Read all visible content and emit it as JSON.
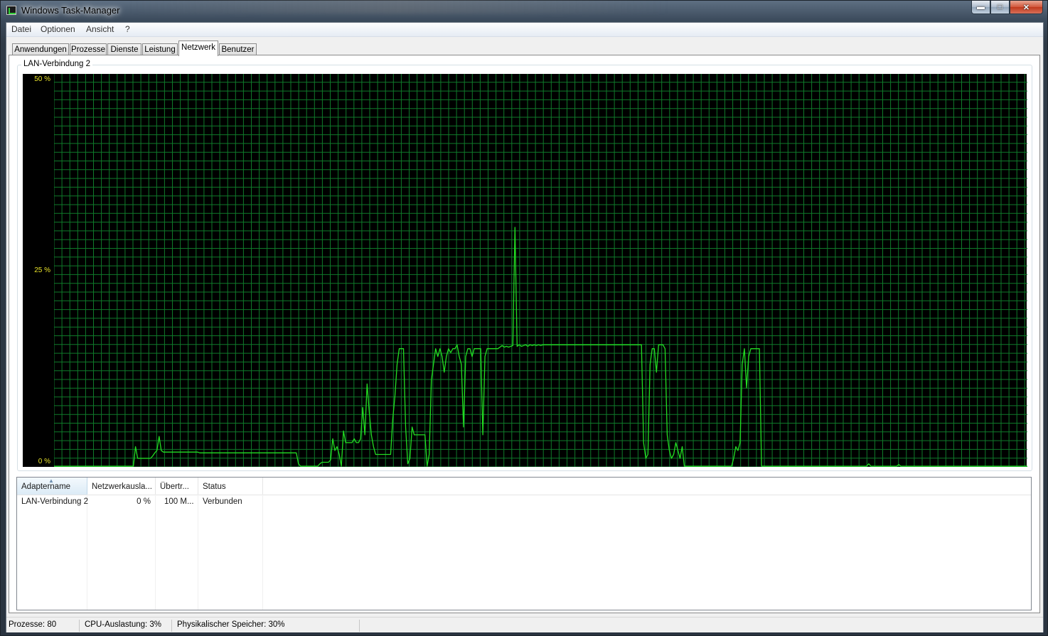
{
  "window": {
    "title": "Windows Task-Manager"
  },
  "menu": [
    "Datei",
    "Optionen",
    "Ansicht",
    "?"
  ],
  "tabs": [
    "Anwendungen",
    "Prozesse",
    "Dienste",
    "Leistung",
    "Netzwerk",
    "Benutzer"
  ],
  "active_tab": "Netzwerk",
  "graph": {
    "title": "LAN-Verbindung 2",
    "y_labels": {
      "top": "50 %",
      "mid": "25 %",
      "bottom": "0 %"
    },
    "colors": {
      "line": "#22dd22",
      "grid": "#0f7a2a",
      "background": "#000000",
      "labels": "#e8e22a"
    }
  },
  "chart_data": {
    "type": "line",
    "title": "LAN-Verbindung 2",
    "xlabel": "",
    "ylabel": "",
    "ylim": [
      0,
      50
    ],
    "grid": true,
    "series": [
      {
        "values": [
          0,
          0,
          0,
          0,
          0,
          0,
          0,
          0,
          0,
          0,
          0,
          0,
          0,
          0,
          0,
          0,
          0,
          0,
          0,
          0,
          0,
          0,
          0,
          0,
          0,
          0,
          0,
          0,
          0,
          0,
          0,
          0,
          0,
          0,
          0,
          0,
          0,
          0,
          2.5,
          1.0,
          1.0,
          1.0,
          1.0,
          1.0,
          1.0,
          1.0,
          1.3,
          1.7,
          2.0,
          3.8,
          2.0,
          1.8,
          1.8,
          1.8,
          1.8,
          1.8,
          1.8,
          1.8,
          1.8,
          1.8,
          1.8,
          1.8,
          1.8,
          1.8,
          1.8,
          1.8,
          1.8,
          1.8,
          1.7,
          1.7,
          1.7,
          1.7,
          1.7,
          1.7,
          1.7,
          1.7,
          1.7,
          1.7,
          1.7,
          1.7,
          1.7,
          1.7,
          1.7,
          1.7,
          1.7,
          1.7,
          1.7,
          1.7,
          1.7,
          1.7,
          1.7,
          1.7,
          1.7,
          1.7,
          1.7,
          1.7,
          1.7,
          1.7,
          1.7,
          1.7,
          1.7,
          1.7,
          1.7,
          1.7,
          1.7,
          1.7,
          1.7,
          1.7,
          1.7,
          1.7,
          1.7,
          1.7,
          1.7,
          1.7,
          0.3,
          0,
          0,
          0,
          0,
          0,
          0,
          0,
          0,
          0,
          0.3,
          0.5,
          0.5,
          0.5,
          0.5,
          0.8,
          3.5,
          2.0,
          2.5,
          1.5,
          0,
          4.5,
          3.0,
          3.0,
          3.0,
          3.0,
          3.5,
          3.0,
          3.0,
          3.5,
          7.5,
          4.0,
          10.5,
          7.0,
          4.0,
          2.5,
          1.5,
          1.5,
          1.5,
          1.5,
          1.5,
          1.5,
          1.5,
          1.5,
          6.0,
          9.0,
          13.0,
          15.0,
          15.0,
          15.0,
          5.0,
          0.3,
          1.0,
          5.0,
          4.0,
          4.0,
          4.0,
          4.0,
          4.0,
          4.0,
          0,
          1.5,
          11.0,
          13.0,
          15.0,
          14.0,
          15.0,
          14.0,
          12.0,
          14.0,
          15.0,
          14.5,
          15.0,
          15.0,
          15.5,
          14.0,
          13.0,
          5.0,
          14.0,
          15.0,
          15.0,
          14.0,
          15.0,
          15.0,
          15.0,
          15.0,
          4.0,
          14.0,
          15.0,
          15.0,
          15.0,
          15.0,
          15.0,
          15.0,
          15.2,
          15.4,
          15.2,
          15.3,
          15.2,
          15.3,
          15.4,
          30.5,
          15.3,
          15.5,
          15.3,
          15.4,
          15.5,
          15.3,
          15.5,
          15.4,
          15.5,
          15.4,
          15.5,
          15.4,
          15.5,
          15.5,
          15.5,
          15.5,
          15.5,
          15.5,
          15.5,
          15.5,
          15.5,
          15.5,
          15.5,
          15.5,
          15.5,
          15.5,
          15.5,
          15.5,
          15.5,
          15.5,
          15.5,
          15.5,
          15.5,
          15.5,
          15.5,
          15.5,
          15.5,
          15.5,
          15.5,
          15.5,
          15.5,
          15.5,
          15.5,
          15.5,
          15.5,
          15.5,
          15.5,
          15.5,
          15.5,
          15.5,
          15.5,
          15.5,
          15.5,
          15.5,
          15.5,
          15.5,
          15.5,
          15.5,
          15.5,
          3.0,
          1.0,
          1.5,
          13.0,
          15.0,
          15.0,
          12.0,
          15.5,
          15.5,
          15.5,
          15.0,
          4.0,
          2.0,
          1.0,
          1.5,
          3.0,
          2.0,
          1.0,
          2.5,
          0,
          0,
          0,
          0,
          0,
          0,
          0,
          0,
          0,
          0,
          0,
          0,
          0,
          0,
          0,
          0,
          0,
          0,
          0,
          0,
          0,
          0,
          0,
          1.0,
          2.5,
          2.0,
          3.0,
          13.0,
          15.0,
          10.0,
          14.0,
          15.0,
          15.0,
          15.0,
          15.0,
          15.0,
          0,
          0,
          0,
          0,
          0,
          0,
          0,
          0,
          0,
          0,
          0,
          0,
          0,
          0,
          0,
          0,
          0,
          0,
          0,
          0,
          0,
          0,
          0,
          0,
          0,
          0,
          0,
          0,
          0,
          0,
          0,
          0,
          0,
          0,
          0,
          0,
          0,
          0,
          0,
          0,
          0,
          0,
          0,
          0,
          0,
          0,
          0,
          0,
          0,
          0,
          0.3,
          0,
          0,
          0,
          0,
          0,
          0,
          0,
          0,
          0,
          0,
          0,
          0,
          0,
          0.2,
          0,
          0,
          0,
          0,
          0,
          0,
          0,
          0,
          0,
          0,
          0,
          0,
          0,
          0,
          0,
          0,
          0,
          0,
          0,
          0,
          0,
          0,
          0,
          0,
          0,
          0,
          0,
          0,
          0,
          0,
          0,
          0,
          0,
          0,
          0,
          0,
          0,
          0,
          0,
          0,
          0,
          0,
          0,
          0,
          0,
          0,
          0,
          0,
          0,
          0,
          0,
          0,
          0,
          0,
          0,
          0,
          0,
          0,
          0,
          0
        ]
      }
    ]
  },
  "adapter_table": {
    "columns": [
      "Adaptername",
      "Netzwerkausla...",
      "Übertr...",
      "Status"
    ],
    "rows": [
      [
        "LAN-Verbindung 2",
        "0 %",
        "100 M...",
        "Verbunden"
      ]
    ]
  },
  "statusbar": {
    "processes": "Prozesse: 80",
    "cpu": "CPU-Auslastung: 3%",
    "memory": "Physikalischer Speicher: 30%"
  }
}
